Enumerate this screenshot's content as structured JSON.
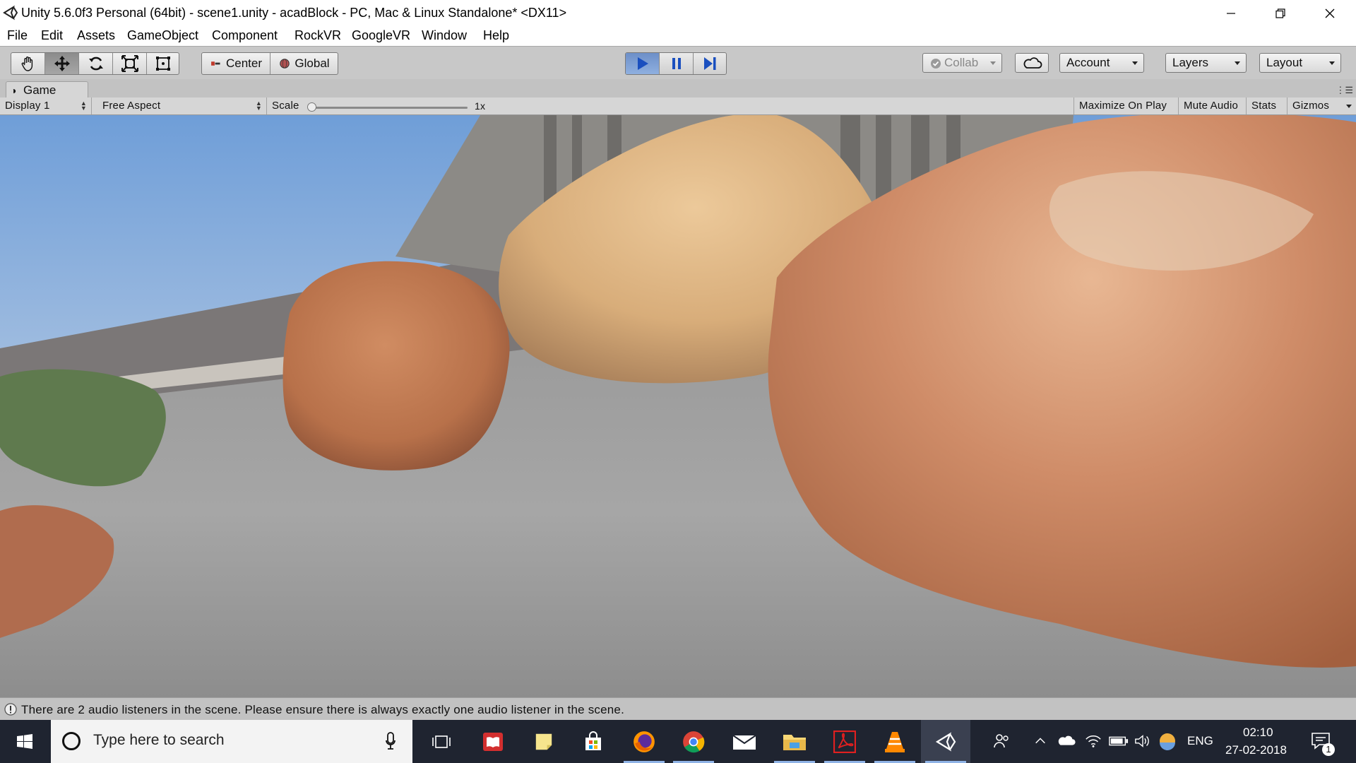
{
  "window": {
    "title": "Unity 5.6.0f3 Personal (64bit) - scene1.unity - acadBlock - PC, Mac & Linux Standalone* <DX11>",
    "controls": [
      "minimize-icon",
      "restore-icon",
      "close-icon"
    ]
  },
  "menu": [
    "File",
    "Edit",
    "Assets",
    "GameObject",
    "Component",
    "RockVR",
    "GoogleVR",
    "Window",
    "Help"
  ],
  "toolbar": {
    "transform_tools": [
      "hand-tool-icon",
      "move-tool-icon",
      "rotate-tool-icon",
      "scale-tool-icon",
      "rect-tool-icon"
    ],
    "active_tool": "move-tool-icon",
    "pivot_mode": "Center",
    "pivot_rotation": "Global",
    "collab": "Collab",
    "account": "Account",
    "layers": "Layers",
    "layout": "Layout"
  },
  "game_panel": {
    "tab_label": "Game",
    "display": "Display 1",
    "aspect": "Free Aspect",
    "scale_label": "Scale",
    "scale_value": "1x",
    "scale_level": 0,
    "maximize_on_play": "Maximize On Play",
    "mute_audio": "Mute Audio",
    "stats": "Stats",
    "gizmos": "Gizmos"
  },
  "status": {
    "message": "There are 2 audio listeners in the scene. Please ensure there is always exactly one audio listener in the scene."
  },
  "taskbar": {
    "search_placeholder": "Type here to search",
    "apps": [
      "task-view-icon",
      "reader-app-icon",
      "sticky-notes-icon",
      "store-icon",
      "firefox-icon",
      "chrome-icon",
      "mail-icon",
      "file-explorer-icon",
      "acrobat-icon",
      "vlc-icon",
      "unity-icon"
    ],
    "tray": {
      "language": "ENG",
      "time": "02:10",
      "date": "27-02-2018",
      "notification_count": "1"
    }
  },
  "colors": {
    "play_active": "#7b9fd8",
    "taskbar": "#1f2430",
    "editor_gray": "#c2c2c2"
  }
}
